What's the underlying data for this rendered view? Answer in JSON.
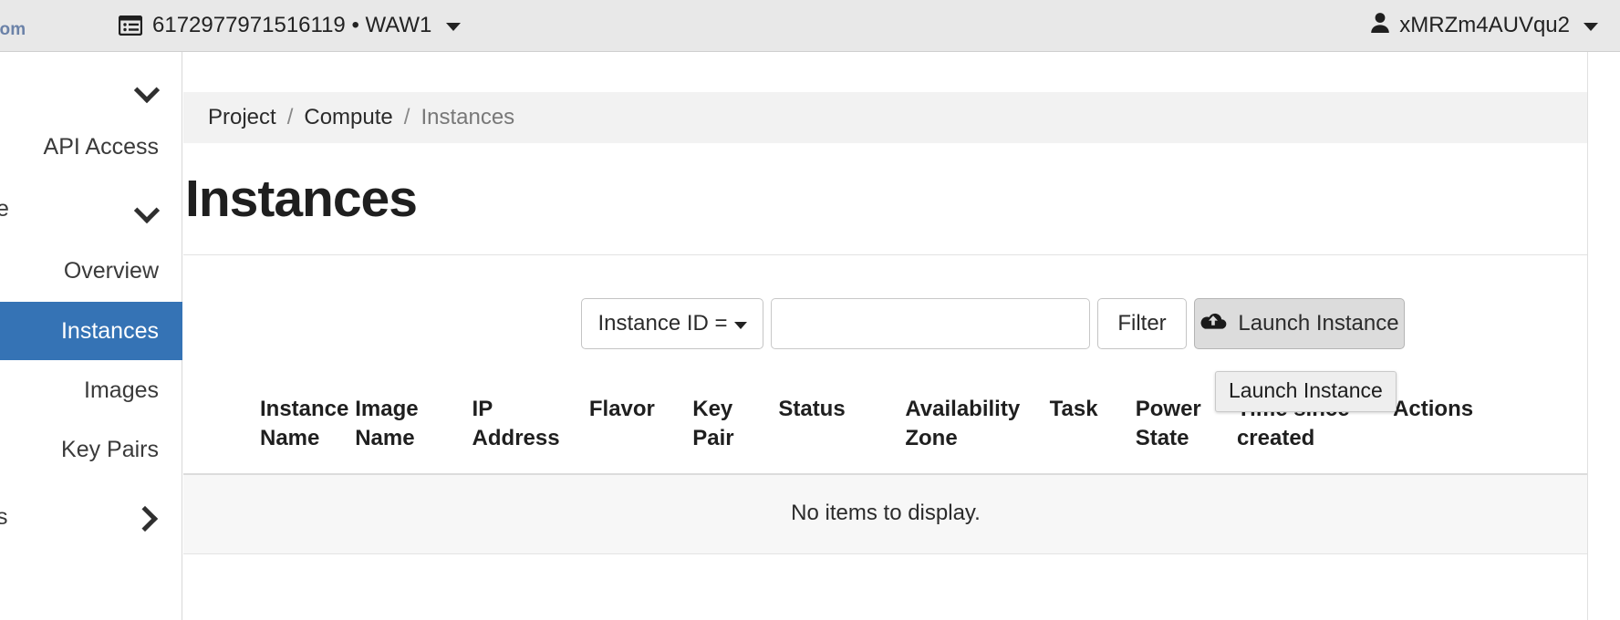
{
  "navbar": {
    "brand_partial": "lom",
    "grid_icon": "list-grid-icon",
    "project_id": "6172977971516119",
    "separator": "•",
    "region": "WAW1",
    "project_switcher_label": "6172977971516119 • WAW1",
    "user_icon": "user-icon",
    "username": "xMRZm4AUVqu2",
    "background": "#e8e8e8"
  },
  "sidebar": {
    "active_color": "#3573b5",
    "items": [
      {
        "label": "",
        "icon": "chevron-down-icon",
        "type": "group-collapsed",
        "active": false
      },
      {
        "label": "API Access",
        "icon": "",
        "type": "link",
        "active": false
      },
      {
        "label": "e",
        "icon": "chevron-down-icon",
        "type": "group-expanded",
        "active": false
      },
      {
        "label": "Overview",
        "icon": "",
        "type": "link",
        "active": false
      },
      {
        "label": "Instances",
        "icon": "",
        "type": "link",
        "active": true
      },
      {
        "label": "Images",
        "icon": "",
        "type": "link",
        "active": false
      },
      {
        "label": "Key Pairs",
        "icon": "",
        "type": "link",
        "active": false
      },
      {
        "label": "s",
        "icon": "chevron-right-icon",
        "type": "group-collapsed",
        "active": false
      }
    ]
  },
  "breadcrumb": {
    "root": "Project",
    "sep": "/",
    "section": "Compute",
    "current": "Instances"
  },
  "main": {
    "page_title": "Instances"
  },
  "toolbar": {
    "filter_type_label": "Instance ID =",
    "filter_type_icon": "caret-down-icon",
    "filter_input_value": "",
    "filter_input_placeholder": "",
    "filter_button_label": "Filter",
    "launch_button_label": "Launch Instance",
    "launch_button_icon": "cloud-upload-icon"
  },
  "tooltip": {
    "text": "Launch Instance"
  },
  "table": {
    "columns": [
      "Instance Name",
      "Image Name",
      "IP Address",
      "Flavor",
      "Key Pair",
      "Status",
      "Availability Zone",
      "Task",
      "Power State",
      "Time since created",
      "Actions"
    ],
    "rows": [],
    "empty_message": "No items to display."
  }
}
